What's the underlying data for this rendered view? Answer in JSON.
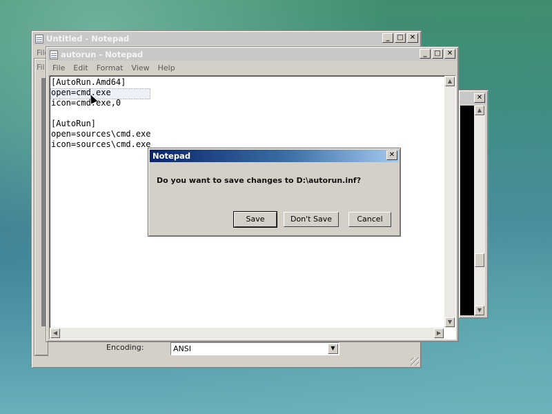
{
  "background_window": {
    "title": "Untitled - Notepad",
    "menu_first_letters": "File"
  },
  "third_window": {
    "menu_first_letters": "Fil"
  },
  "main_window": {
    "title": "autorun - Notepad",
    "menu": [
      "File",
      "Edit",
      "Format",
      "View",
      "Help"
    ],
    "content_lines": [
      "[AutoRun.Amd64]",
      "open=cmd.exe",
      "icon=cmd.exe,0",
      "",
      "[AutoRun]",
      "open=sources\\cmd.exe",
      "icon=sources\\cmd.exe"
    ]
  },
  "save_as_panel": {
    "encoding_label": "Encoding:",
    "encoding_value": "ANSI"
  },
  "dialog": {
    "title": "Notepad",
    "message": "Do you want to save changes to D:\\autorun.inf?",
    "buttons": {
      "save": "Save",
      "dont_save": "Don't Save",
      "cancel": "Cancel"
    }
  },
  "window_controls": {
    "minimize": "_",
    "maximize": "□",
    "close": "✕"
  },
  "colors": {
    "dialog_title_start": "#0a246a",
    "dialog_title_end": "#a6caf0"
  }
}
